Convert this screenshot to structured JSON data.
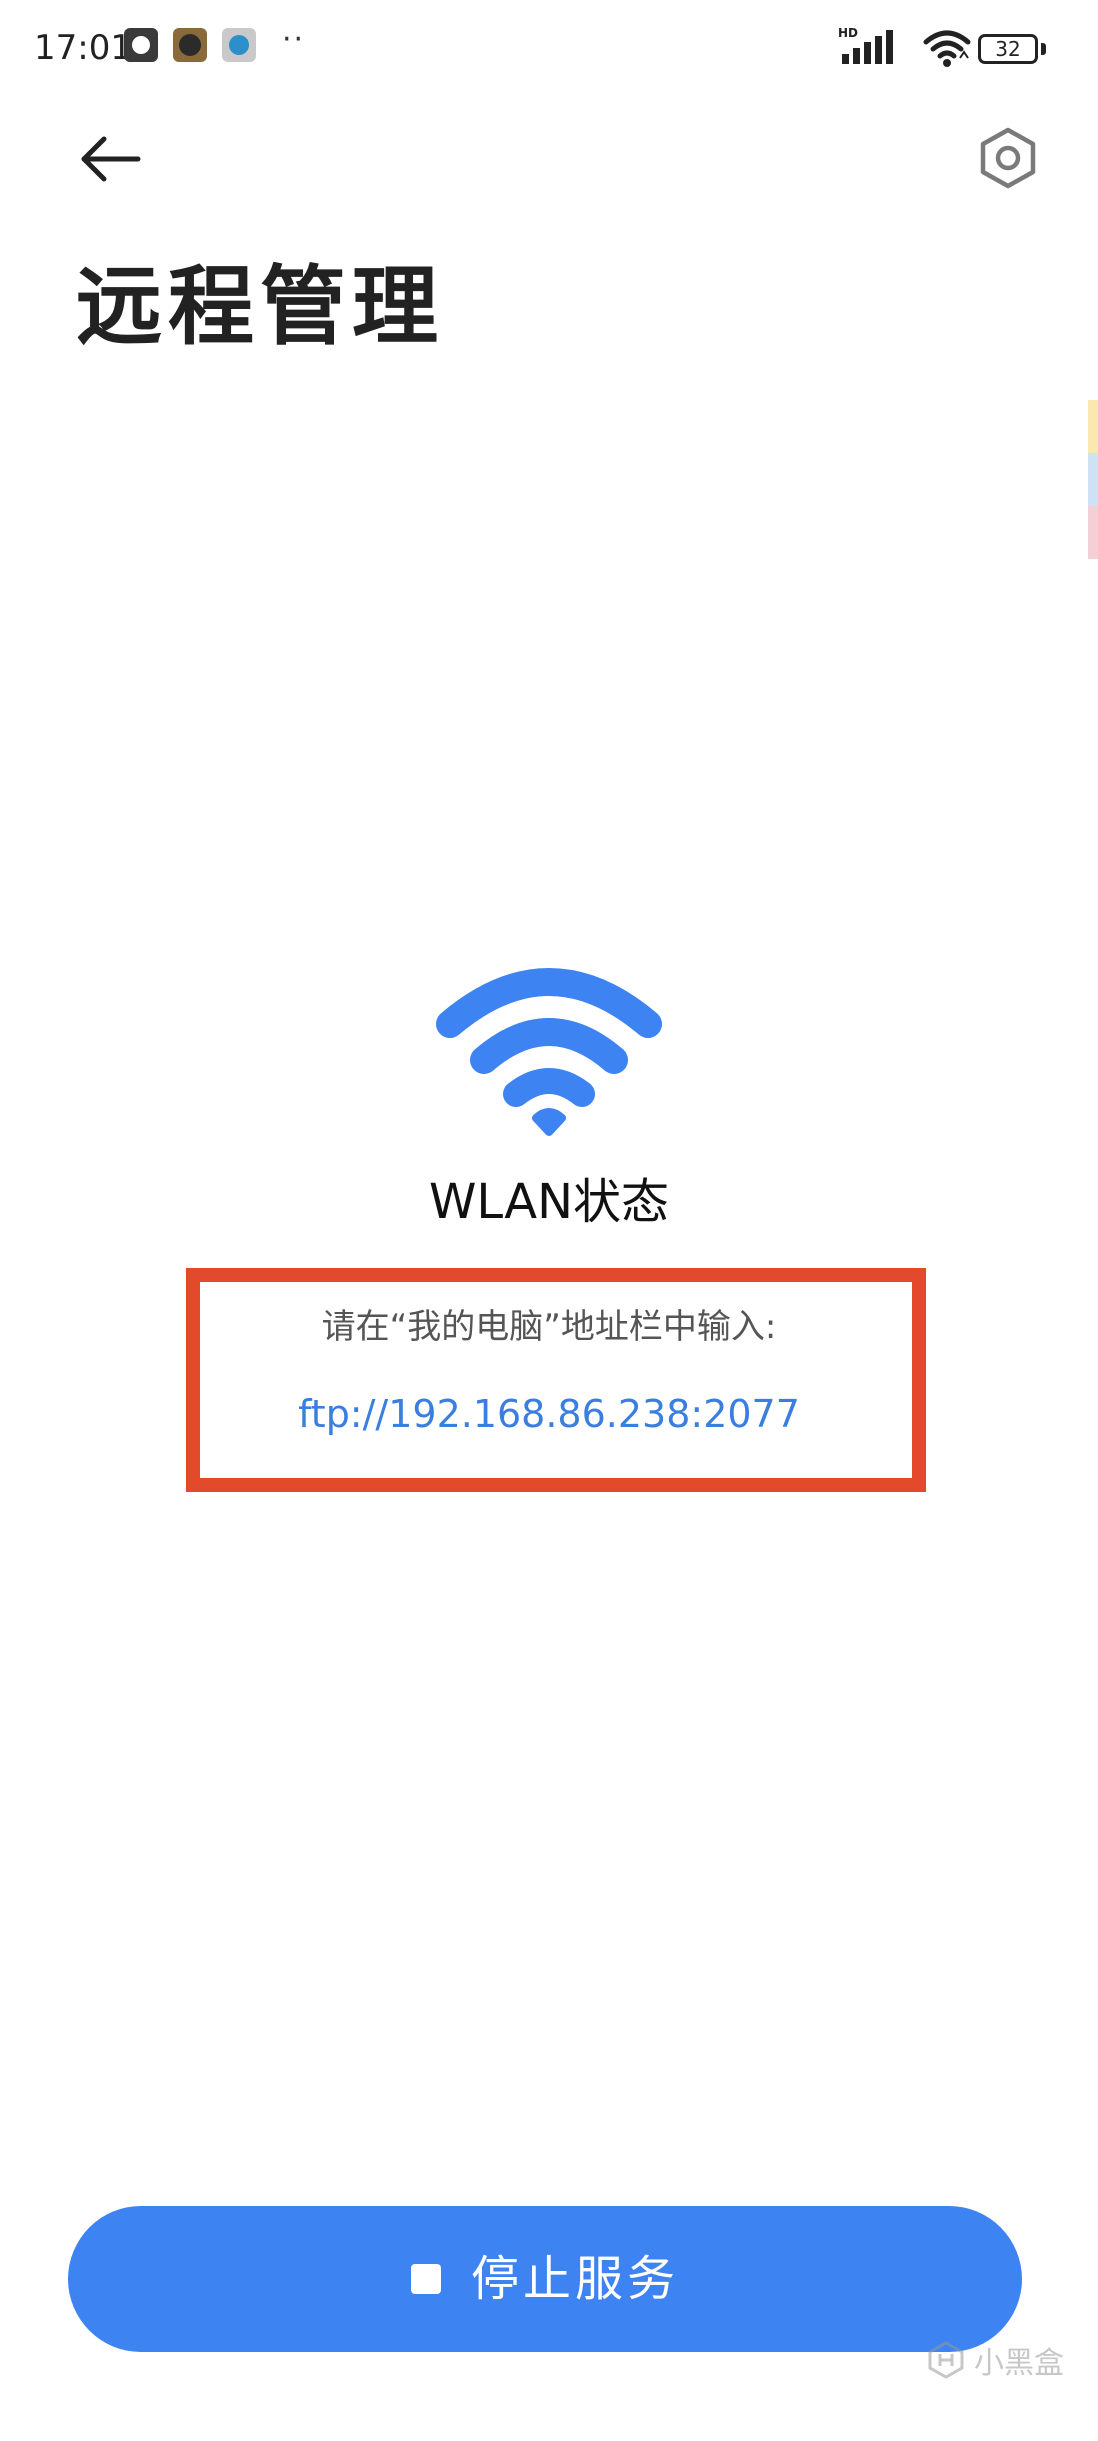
{
  "status_bar": {
    "time": "17:01",
    "overflow_dots": "··",
    "network": "HD",
    "battery_level": "32"
  },
  "header": {
    "back_icon": "arrow-left-icon",
    "settings_icon": "hexagon-gear-icon",
    "title": "远程管理"
  },
  "main": {
    "wifi_icon": "wifi-icon",
    "wifi_color": "#3d83f2",
    "status_label": "WLAN状态",
    "instruction": "请在“我的电脑”地址栏中输入:",
    "ftp_address": "ftp://192.168.86.238:2077",
    "highlight_color": "#e34a2c"
  },
  "footer": {
    "stop_button_label": "停止服务",
    "stop_icon": "stop-square-icon",
    "button_color": "#3d83f2"
  },
  "watermark": {
    "label": "小黑盒"
  }
}
